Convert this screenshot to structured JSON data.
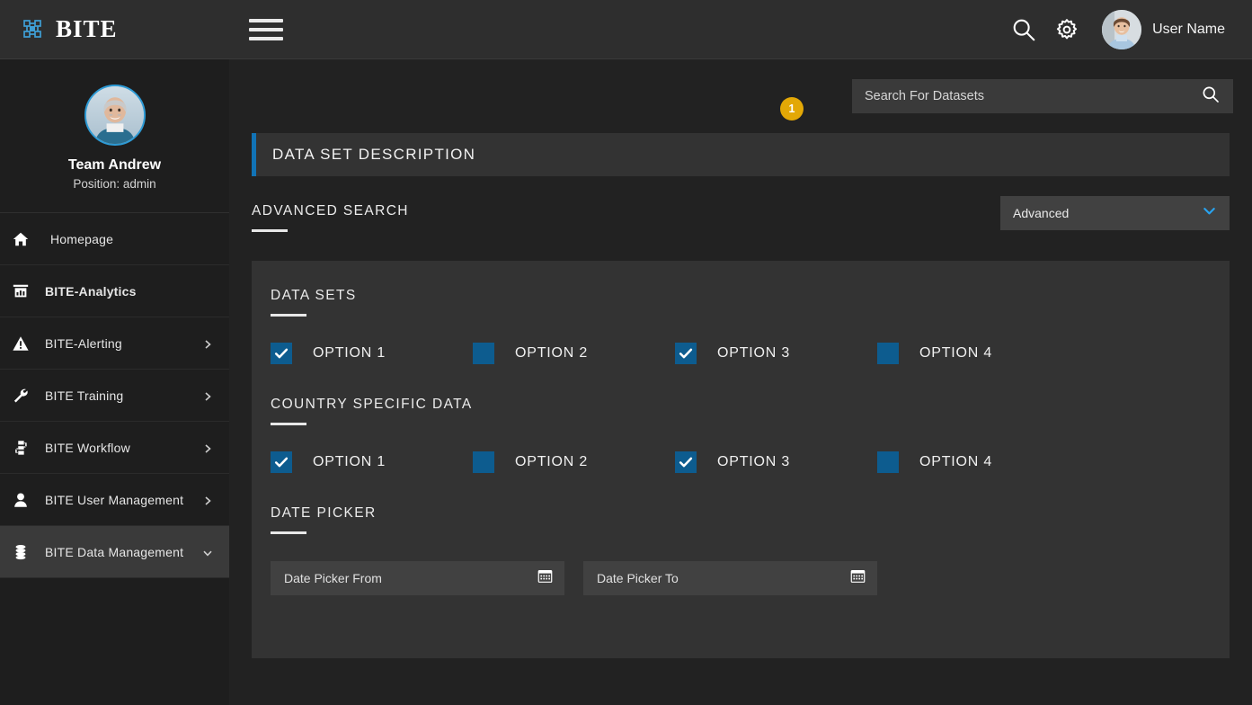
{
  "brand": {
    "name": "BITE",
    "logo_icon": "bite-node-logo-icon"
  },
  "topbar": {
    "menu_icon": "hamburger-menu-icon",
    "search_icon": "search-icon",
    "settings_icon": "gear-icon",
    "avatar_icon": "user-avatar",
    "user_name": "User Name"
  },
  "sidebar": {
    "profile": {
      "avatar_icon": "profile-avatar",
      "name": "Team Andrew",
      "position": "Position: admin"
    },
    "items": [
      {
        "label": "Homepage",
        "icon": "home-icon",
        "chevron": "",
        "active": false,
        "bold": false
      },
      {
        "label": "BITE-Analytics",
        "icon": "analytics-chart-icon",
        "chevron": "",
        "active": false,
        "bold": true
      },
      {
        "label": "BITE-Alerting",
        "icon": "alert-triangle-icon",
        "chevron": "chevron-right-icon",
        "active": false,
        "bold": false
      },
      {
        "label": "BITE Training",
        "icon": "wrench-icon",
        "chevron": "chevron-right-icon",
        "active": false,
        "bold": false
      },
      {
        "label": "BITE Workflow",
        "icon": "workflow-icon",
        "chevron": "chevron-right-icon",
        "active": false,
        "bold": false
      },
      {
        "label": "BITE User Management",
        "icon": "user-icon",
        "chevron": "chevron-right-icon",
        "active": false,
        "bold": false
      },
      {
        "label": "BITE Data Management",
        "icon": "database-icon",
        "chevron": "chevron-down-icon",
        "active": true,
        "bold": false
      }
    ]
  },
  "search": {
    "placeholder": "Search For Datasets",
    "value": "",
    "icon": "search-icon",
    "badge_count": "1"
  },
  "page": {
    "title": "DATA SET DESCRIPTION",
    "advanced_search_label": "ADVANCED SEARCH",
    "advanced_select": {
      "value": "Advanced",
      "chevron_icon": "chevron-down-icon"
    }
  },
  "groups": [
    {
      "title": "DATA SETS",
      "options": [
        {
          "label": "OPTION 1",
          "checked": true
        },
        {
          "label": "OPTION 2",
          "checked": false
        },
        {
          "label": "OPTION 3",
          "checked": true
        },
        {
          "label": "OPTION 4",
          "checked": false
        }
      ]
    },
    {
      "title": "COUNTRY SPECIFIC DATA",
      "options": [
        {
          "label": "OPTION 1",
          "checked": true
        },
        {
          "label": "OPTION 2",
          "checked": false
        },
        {
          "label": "OPTION 3",
          "checked": true
        },
        {
          "label": "OPTION 4",
          "checked": false
        }
      ]
    }
  ],
  "date_picker": {
    "title": "DATE PICKER",
    "from": {
      "placeholder": "Date Picker From",
      "value": "",
      "icon": "calendar-icon"
    },
    "to": {
      "placeholder": "Date Picker To",
      "value": "",
      "icon": "calendar-icon"
    }
  },
  "colors": {
    "accent_blue": "#1173b6",
    "checkbox_blue": "#0d5c8f",
    "badge_amber": "#e3a806",
    "panel_bg": "#333333",
    "page_bg": "#222222",
    "topbar_bg": "#2e2e2e",
    "sidebar_bg": "#1e1e1e"
  }
}
